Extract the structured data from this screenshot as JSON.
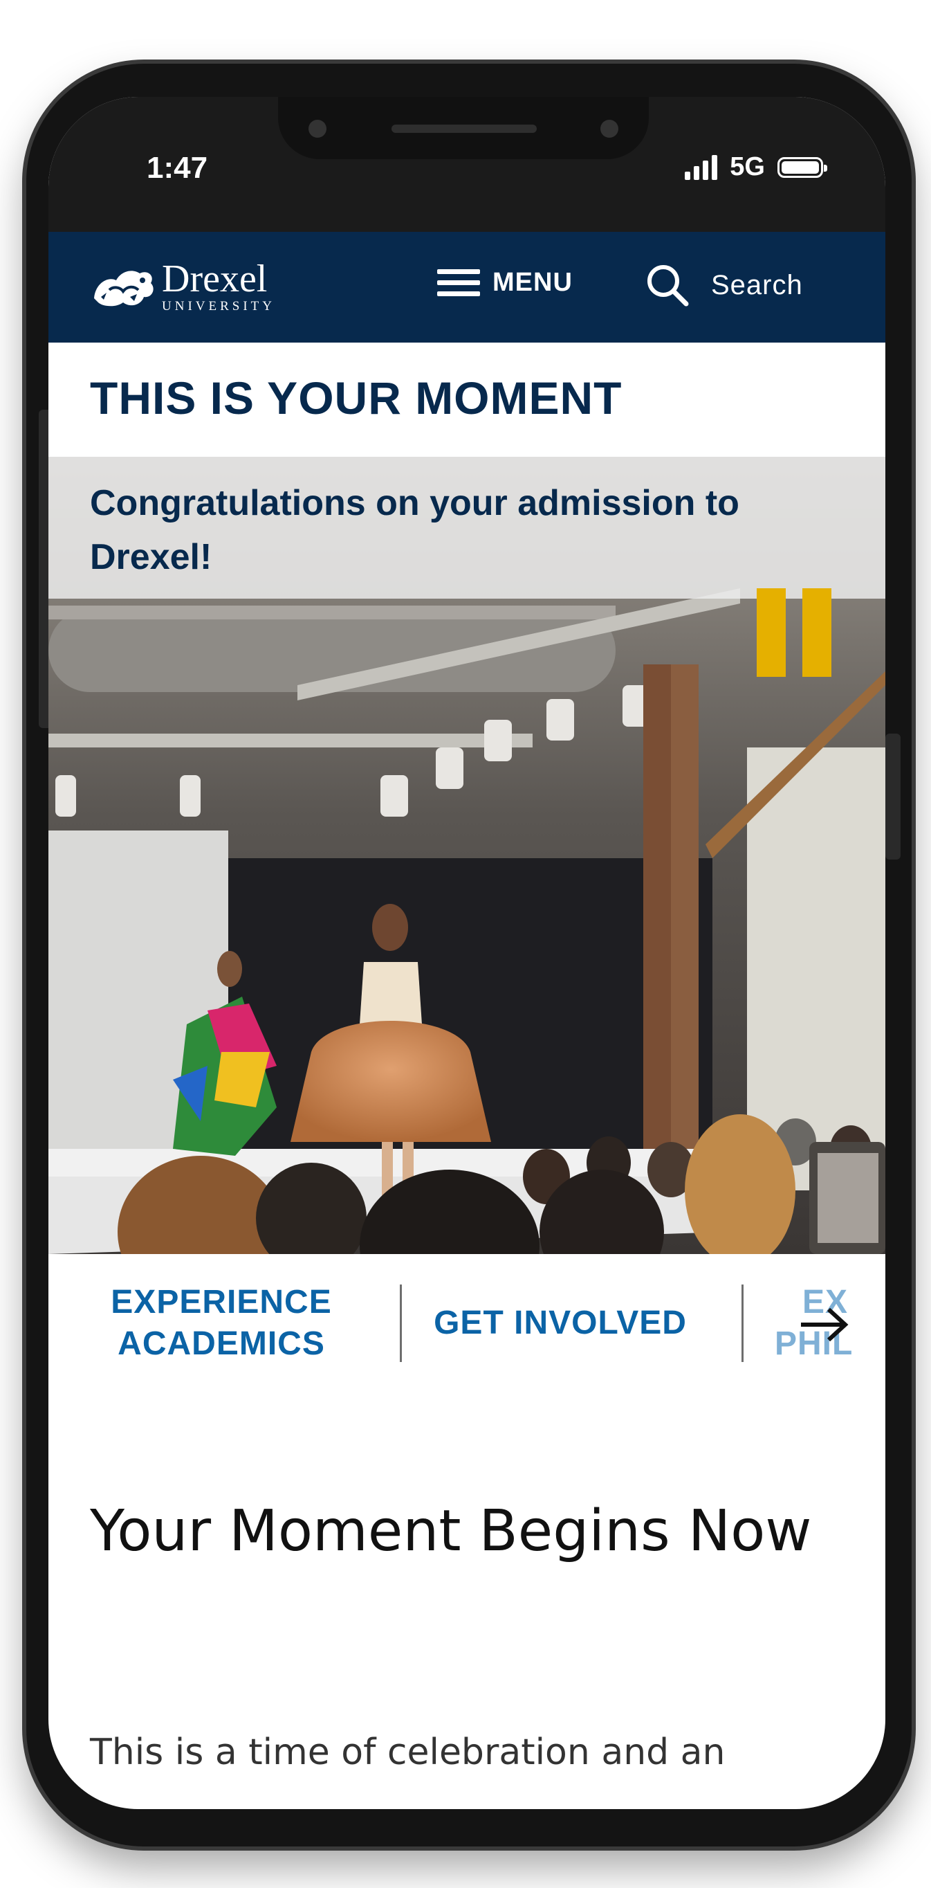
{
  "status_bar": {
    "time": "1:47",
    "network": "5G",
    "icons": [
      "signal-bars-icon",
      "battery-icon"
    ]
  },
  "header": {
    "logo": {
      "name": "Drexel",
      "subtitle": "UNIVERSITY",
      "icon": "dragon-logo-icon"
    },
    "menu_label": "MENU",
    "search_label": "Search",
    "colors": {
      "navy": "#07294d",
      "link_blue": "#0b63a6",
      "accent_gold": "#e5b000"
    }
  },
  "hero": {
    "title": "THIS IS YOUR MOMENT",
    "subtitle": "Congratulations on your admission to Drexel!",
    "media_control": "pause-icon"
  },
  "quick_links": {
    "items": [
      {
        "label_line1": "EXPERIENCE",
        "label_line2": "ACADEMICS"
      },
      {
        "label_line1": "GET INVOLVED"
      },
      {
        "label_line1": "EX",
        "label_line2": "PHIL"
      }
    ],
    "next_icon": "arrow-right-icon"
  },
  "main": {
    "section_title": "Your Moment Begins Now",
    "body_text": "This is a time of celebration and an"
  }
}
